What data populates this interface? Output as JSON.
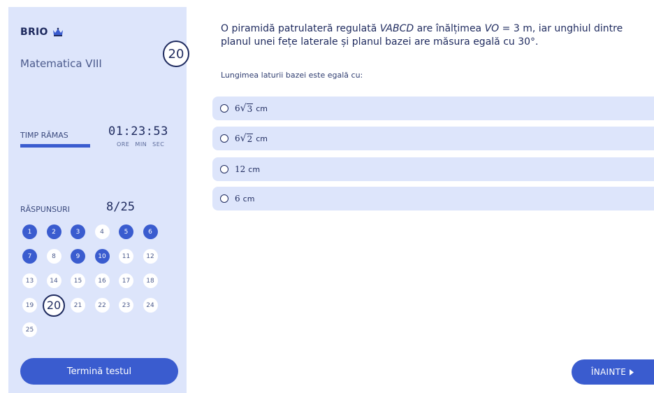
{
  "brand": {
    "name": "BRIO"
  },
  "subject": "Matematica VIII",
  "current_question": "20",
  "timer": {
    "label": "TIMP RĂMAS",
    "value": "01:23:53",
    "units": [
      "ORE",
      "MIN",
      "SEC"
    ],
    "remaining_fraction": 0.45
  },
  "answers": {
    "label": "RĂSPUNSURI",
    "value": "8/25",
    "items": [
      {
        "n": "1",
        "answered": true
      },
      {
        "n": "2",
        "answered": true
      },
      {
        "n": "3",
        "answered": true
      },
      {
        "n": "4",
        "answered": false
      },
      {
        "n": "5",
        "answered": true
      },
      {
        "n": "6",
        "answered": true
      },
      {
        "n": "7",
        "answered": true
      },
      {
        "n": "8",
        "answered": false
      },
      {
        "n": "9",
        "answered": true
      },
      {
        "n": "10",
        "answered": true
      },
      {
        "n": "11",
        "answered": false
      },
      {
        "n": "12",
        "answered": false
      },
      {
        "n": "13",
        "answered": false
      },
      {
        "n": "14",
        "answered": false
      },
      {
        "n": "15",
        "answered": false
      },
      {
        "n": "16",
        "answered": false
      },
      {
        "n": "17",
        "answered": false
      },
      {
        "n": "18",
        "answered": false
      },
      {
        "n": "19",
        "answered": false
      },
      {
        "n": "20",
        "answered": false,
        "current": true
      },
      {
        "n": "21",
        "answered": false
      },
      {
        "n": "22",
        "answered": false
      },
      {
        "n": "23",
        "answered": false
      },
      {
        "n": "24",
        "answered": false
      },
      {
        "n": "25",
        "answered": false
      }
    ]
  },
  "finish_button": "Termină testul",
  "question": {
    "part1": "O piramidă patrulateră regulată ",
    "italic1": "VABCD",
    "part2": " are înălțimea ",
    "italic2": "VO",
    "part3": " = 3 m, iar unghiul dintre planul unei fețe laterale și planul bazei are măsura egală cu 30°.",
    "prompt": "Lungimea laturii bazei este egală cu:"
  },
  "options": [
    {
      "coef": "6",
      "radicand": "3",
      "unit": "cm"
    },
    {
      "coef": "6",
      "radicand": "2",
      "unit": "cm"
    },
    {
      "coef": "12",
      "radicand": "",
      "unit": "cm"
    },
    {
      "coef": "6",
      "radicand": "",
      "unit": "cm"
    }
  ],
  "next_button": "ÎNAINTE",
  "colors": {
    "accent": "#3a5ccf",
    "panel": "#dde5fb",
    "text": "#1e2a5e"
  }
}
